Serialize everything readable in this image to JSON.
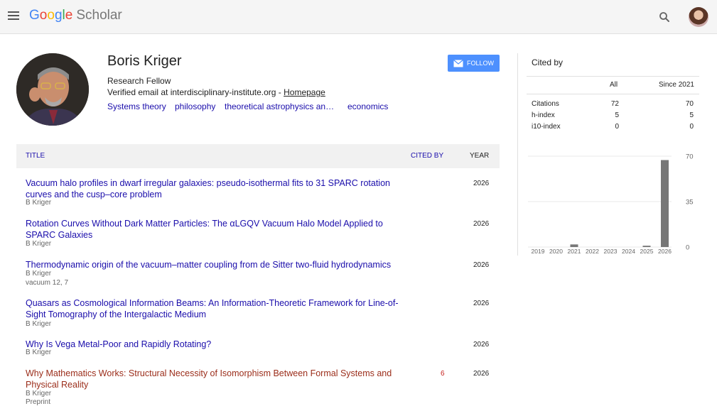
{
  "header": {
    "logo_letters": [
      "G",
      "o",
      "o",
      "g",
      "l",
      "e"
    ],
    "logo_suffix": "Scholar",
    "menu_icon": "hamburger-menu-icon",
    "search_icon": "search-icon",
    "account_icon": "account-avatar"
  },
  "profile": {
    "name": "Boris Kriger",
    "affiliation": "Research Fellow",
    "email_text": "Verified email at interdisciplinary-institute.org - ",
    "homepage_label": "Homepage",
    "interests": [
      "Systems theory",
      "philosophy",
      "theoretical astrophysics an…",
      "economics"
    ],
    "follow_label": "FOLLOW"
  },
  "table": {
    "headers": {
      "title": "TITLE",
      "cited_by": "CITED BY",
      "year": "YEAR"
    },
    "articles": [
      {
        "title": "Vacuum halo profiles in dwarf irregular galaxies: pseudo-isothermal fits to 31 SPARC rotation curves and the cusp–core problem",
        "authors": "B Kriger",
        "venue": "",
        "cited_by": "",
        "year": "2026",
        "visited": false
      },
      {
        "title": "Rotation Curves Without Dark Matter Particles: The αLGQV Vacuum Halo Model Applied to SPARC Galaxies",
        "authors": "B Kriger",
        "venue": "",
        "cited_by": "",
        "year": "2026",
        "visited": false
      },
      {
        "title": "Thermodynamic origin of the vacuum–matter coupling from de Sitter two-fluid hydrodynamics",
        "authors": "B Kriger",
        "venue": "vacuum 12, 7",
        "cited_by": "",
        "year": "2026",
        "visited": false
      },
      {
        "title": "Quasars as Cosmological Information Beams: An Information-Theoretic Framework for Line-of-Sight Tomography of the Intergalactic Medium",
        "authors": "B Kriger",
        "venue": "",
        "cited_by": "",
        "year": "2026",
        "visited": false
      },
      {
        "title": "Why Is Vega Metal-Poor and Rapidly Rotating?",
        "authors": "B Kriger",
        "venue": "",
        "cited_by": "",
        "year": "2026",
        "visited": false
      },
      {
        "title": "Why Mathematics Works: Structural Necessity of Isomorphism Between Formal Systems and Physical Reality",
        "authors": "B Kriger",
        "venue": "Preprint",
        "cited_by": "6",
        "year": "2026",
        "visited": true
      }
    ]
  },
  "cited_by": {
    "title": "Cited by",
    "columns": [
      "",
      "All",
      "Since 2021"
    ],
    "rows": [
      {
        "label": "Citations",
        "all": "72",
        "since": "70"
      },
      {
        "label": "h-index",
        "all": "5",
        "since": "5"
      },
      {
        "label": "i10-index",
        "all": "0",
        "since": "0"
      }
    ]
  },
  "chart_data": {
    "type": "bar",
    "categories": [
      "2019",
      "2020",
      "2021",
      "2022",
      "2023",
      "2024",
      "2025",
      "2026"
    ],
    "values": [
      0,
      0,
      2,
      0,
      0,
      0,
      1,
      67
    ],
    "title": "",
    "xlabel": "",
    "ylabel": "",
    "ylim": [
      0,
      70
    ],
    "yticks": [
      "70",
      "35",
      "0"
    ],
    "grid": true,
    "bar_color": "#777777"
  }
}
